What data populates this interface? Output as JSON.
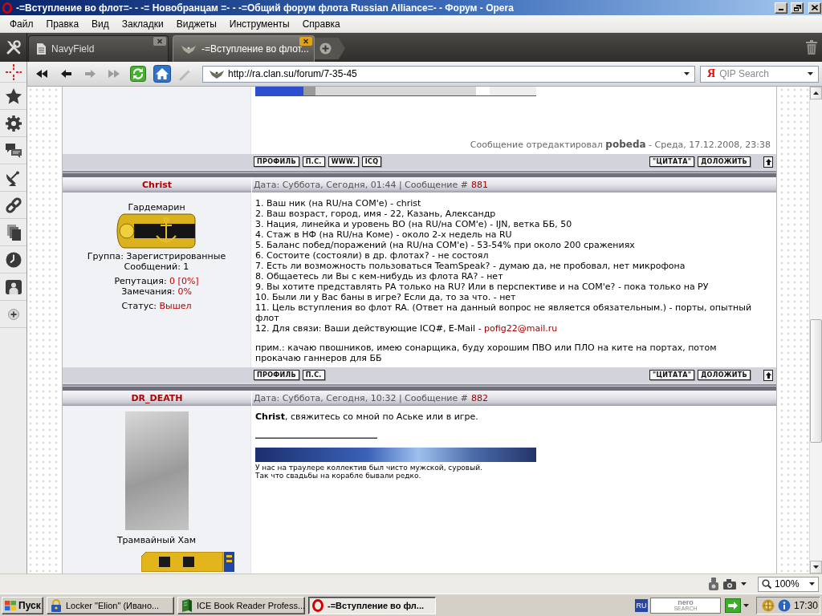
{
  "window": {
    "title": "-=Вступление во флот=- - -= Новобранцам =- - -=Общий форум флота Russian Alliance=- - Форум - Opera"
  },
  "menu": [
    "Файл",
    "Правка",
    "Вид",
    "Закладки",
    "Виджеты",
    "Инструменты",
    "Справка"
  ],
  "tabs": [
    {
      "kind": "document",
      "label": "NavyField",
      "selected": false
    },
    {
      "kind": "site",
      "label": "-=Вступление во флот...",
      "selected": true
    }
  ],
  "nav_buttons": [
    {
      "kind": "rewind",
      "disabled": false
    },
    {
      "kind": "back",
      "disabled": false
    },
    {
      "kind": "forward",
      "disabled": true
    },
    {
      "kind": "fast_forward",
      "disabled": true
    },
    {
      "kind": "reload",
      "disabled": false
    },
    {
      "kind": "home",
      "disabled": false
    },
    {
      "kind": "wand",
      "disabled": true
    }
  ],
  "address": {
    "value": "http://ra.clan.su/forum/7-35-45"
  },
  "search": {
    "engine_mark": "Я",
    "placeholder": "QIP Search"
  },
  "posts": [
    {
      "body": [
        {
          "kind": "banner"
        },
        {
          "kind": "edit_note",
          "text": "Сообщение отредактировал **pobeda** - Среда, 17.12.2008, 23:38"
        }
      ],
      "actions_left": [
        "ПРОФИЛЬ",
        "П.С.",
        "WWW.",
        "ICQ"
      ],
      "actions_right": [
        "\"ЦИТАТА\"",
        "ДОЛОЖИТЬ"
      ]
    },
    {
      "author": "Christ",
      "date": "Дата: Суббота, Сегодня, 01:44 | Сообщение #",
      "number": "881",
      "profile": [
        {
          "kind": "text",
          "text": "Гардемарин"
        },
        {
          "kind": "epaulette"
        },
        {
          "kind": "group",
          "lines": [
            {
              "label": "Группа: Зарегистрированные"
            },
            {
              "label": "Сообщений: 1"
            }
          ]
        },
        {
          "kind": "group",
          "lines": [
            {
              "label": "Репутация:",
              "value": "0 [0%]"
            },
            {
              "label": "Замечания:",
              "value": "0%"
            }
          ]
        },
        {
          "kind": "group",
          "lines": [
            {
              "label": "Статус:",
              "value": "Вышел"
            }
          ]
        }
      ],
      "body": [
        {
          "kind": "line",
          "text": "1. Ваш ник (на RU/на COM'e) - christ"
        },
        {
          "kind": "line",
          "text": "2. Ваш возраст, город, имя - 22, Казань, Александр"
        },
        {
          "kind": "line",
          "text": "3. Нация, линейка и уровень ВО (на RU/на COM'e) - IJN, ветка ББ, 50"
        },
        {
          "kind": "line",
          "text": "4. Стаж в НФ (на RU/на Коме) - около 2-х недель на RU"
        },
        {
          "kind": "line",
          "text": "5. Баланс побед/поражений (на RU/на COM'e) - 53-54% при около 200 сражениях"
        },
        {
          "kind": "line",
          "text": "6. Состоите (состояли) в др. флотах? - не состоял"
        },
        {
          "kind": "line",
          "text": "7. Есть ли возможность пользоваться TeamSpeak? - думаю да, не пробовал, нет микрофона"
        },
        {
          "kind": "line",
          "text": "8. Общаетесь ли Вы с кем-нибудь из флота RA? - нет"
        },
        {
          "kind": "line",
          "text": "9. Вы хотите представлять РА только на RU? Или в перспективе и на COM'e? - пока только на РУ"
        },
        {
          "kind": "line",
          "text": "10. Были ли у Вас баны в игре? Если да, то за что. - нет"
        },
        {
          "kind": "line",
          "text": "11. Цель вступления во флот RA. (Ответ на данный вопрос не является обязательным.) - порты, опытный флот"
        },
        {
          "kind": "line",
          "text": "12. Для связи: Ваши действующие ICQ#, E-Mail -",
          "link": "pofig22@mail.ru"
        },
        {
          "kind": "paragraph",
          "text": "прим.: качаю пвошников, имею сонарщика, буду хорошим ПВО или ПЛО на ките на портах, потом прокачаю ганнеров для ББ"
        }
      ],
      "actions_left": [
        "ПРОФИЛЬ",
        "П.С."
      ],
      "actions_right": [
        "\"ЦИТАТА\"",
        "ДОЛОЖИТЬ"
      ]
    },
    {
      "author": "DR_DEATH",
      "date": "Дата: Суббота, Сегодня, 10:32 | Сообщение #",
      "number": "882",
      "profile": [
        {
          "kind": "avatar"
        },
        {
          "kind": "text",
          "text": "Трамвайный Хам"
        },
        {
          "kind": "badge"
        }
      ],
      "body": [
        {
          "kind": "message",
          "text": "**Christ**, свяжитесь со мной по Аське или в игре."
        },
        {
          "kind": "rule"
        },
        {
          "kind": "banner"
        },
        {
          "kind": "small",
          "text": "У нас на траулере коллектив был чисто мужской, суровый."
        },
        {
          "kind": "small",
          "text": "Так что свадьбы на корабле бывали редко."
        }
      ]
    }
  ],
  "status_bar": {
    "zoom": "100%"
  },
  "taskbar": {
    "start": "Пуск",
    "tasks": [
      {
        "kind": "locker",
        "label": "Locker \"Elion\" (Ивано...",
        "selected": false
      },
      {
        "kind": "reader",
        "label": "ICE Book Reader Profess...",
        "selected": false
      },
      {
        "kind": "browser",
        "label": "-=Вступление во фл...",
        "selected": true
      }
    ],
    "language": "RU",
    "search_logo": {
      "top": "nero",
      "bottom": "SEARCH"
    },
    "clock": "17:30"
  }
}
